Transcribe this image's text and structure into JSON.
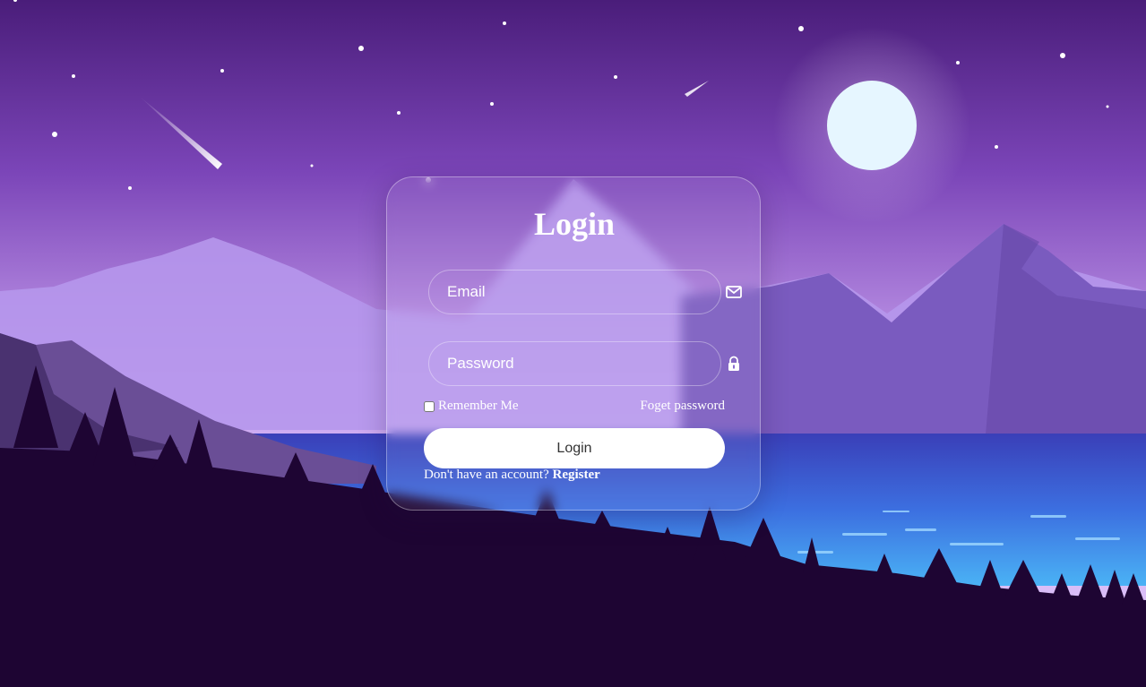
{
  "form": {
    "title": "Login",
    "email_placeholder": "Email",
    "email_value": "",
    "password_placeholder": "Password",
    "password_value": "",
    "email_icon": "mail-icon",
    "password_icon": "lock-icon",
    "remember_label": "Remember Me",
    "remember_checked": false,
    "forgot_label": "Foget password",
    "login_button_label": "Login",
    "register_prompt": "Don't have an account?",
    "register_link": "Register"
  },
  "colors": {
    "sky_top": "#4a1d7a",
    "sky_mid": "#a070d8",
    "lake": "#3b45c9",
    "foreground": "#1e0533",
    "moon": "#e6f6ff",
    "button_bg": "#ffffff",
    "button_text": "#333333"
  }
}
